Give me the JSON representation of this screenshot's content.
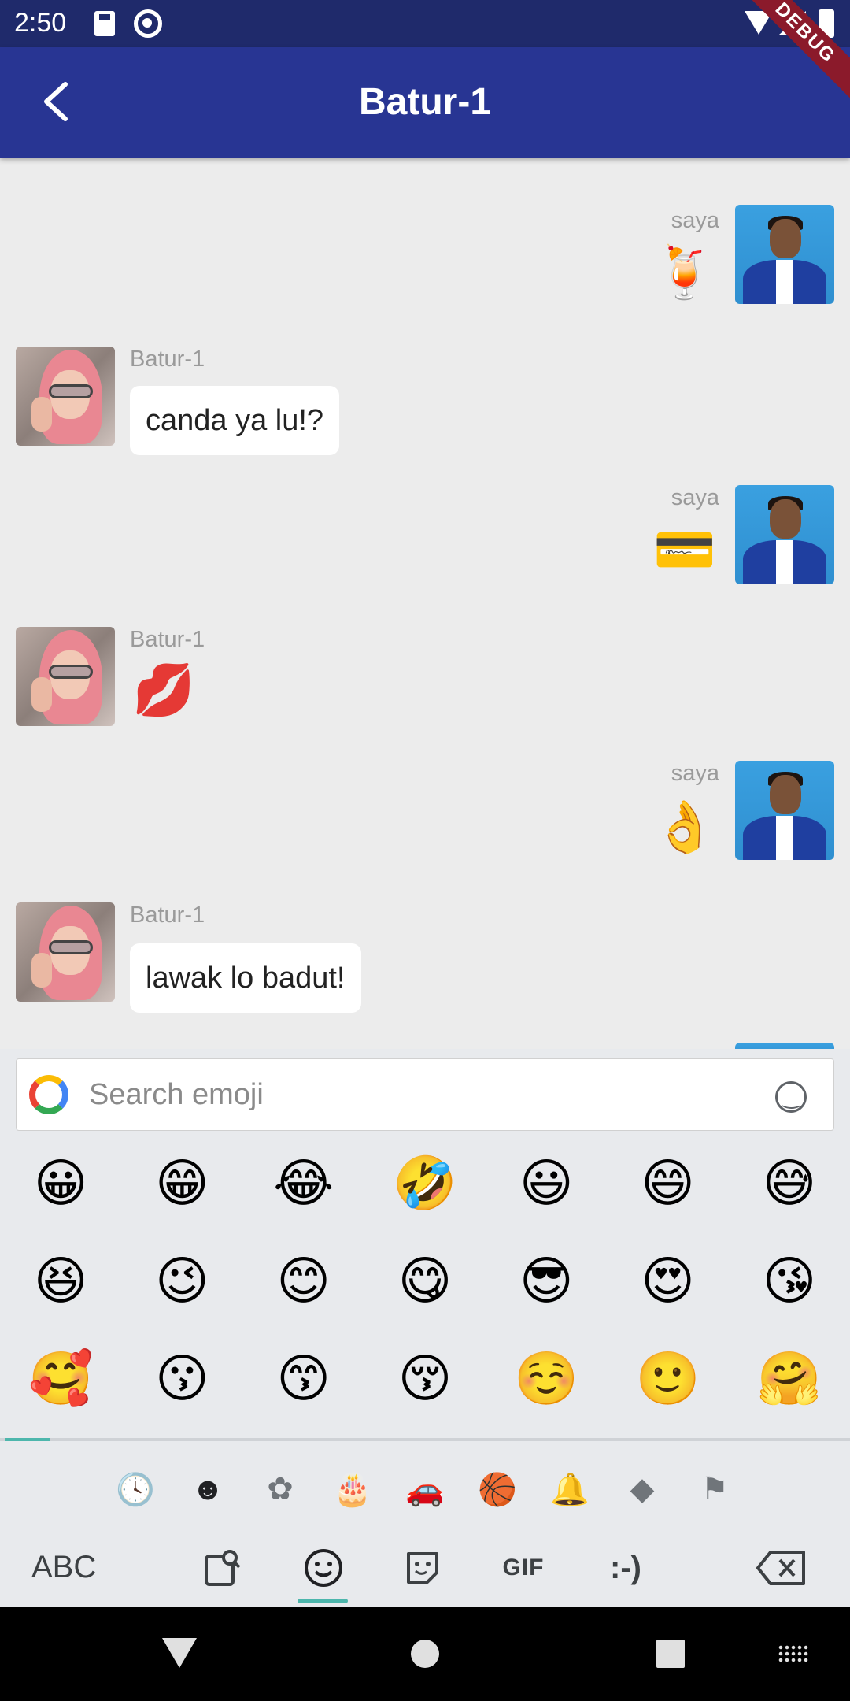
{
  "status_bar": {
    "time": "2:50"
  },
  "app_bar": {
    "title": "Batur-1",
    "debug_label": "DEBUG"
  },
  "messages": [
    {
      "sender": "saya",
      "type": "sticker",
      "content": "🍹"
    },
    {
      "sender": "Batur-1",
      "type": "text",
      "content": "canda ya lu!?"
    },
    {
      "sender": "saya",
      "type": "sticker",
      "content": "💳"
    },
    {
      "sender": "Batur-1",
      "type": "sticker",
      "content": "💋"
    },
    {
      "sender": "saya",
      "type": "sticker",
      "content": "👌"
    },
    {
      "sender": "Batur-1",
      "type": "text",
      "content": "lawak lo badut!"
    }
  ],
  "keyboard": {
    "search_placeholder": "Search emoji",
    "emojis": [
      "😀",
      "😁",
      "😂",
      "🤣",
      "😃",
      "😄",
      "😅",
      "😆",
      "😉",
      "😊",
      "😋",
      "😎",
      "😍",
      "😘",
      "🥰",
      "😗",
      "😙",
      "😚",
      "☺️",
      "🙂",
      "🤗"
    ],
    "categories": [
      {
        "icon": "clock-icon",
        "glyph": "🕓"
      },
      {
        "icon": "smiley-icon",
        "glyph": "☻"
      },
      {
        "icon": "flower-icon",
        "glyph": "✿"
      },
      {
        "icon": "cake-icon",
        "glyph": "🎂"
      },
      {
        "icon": "car-icon",
        "glyph": "🚗"
      },
      {
        "icon": "ball-icon",
        "glyph": "🏀"
      },
      {
        "icon": "bell-icon",
        "glyph": "🔔"
      },
      {
        "icon": "diamond-icon",
        "glyph": "◆"
      },
      {
        "icon": "flag-icon",
        "glyph": "⚑"
      }
    ],
    "abc_label": "ABC",
    "gif_label": "GIF",
    "emoticon_label": ":-)"
  },
  "colors": {
    "app_bar": "#283593",
    "status_bar": "#1f2a6b",
    "accent": "#4db6ac"
  }
}
